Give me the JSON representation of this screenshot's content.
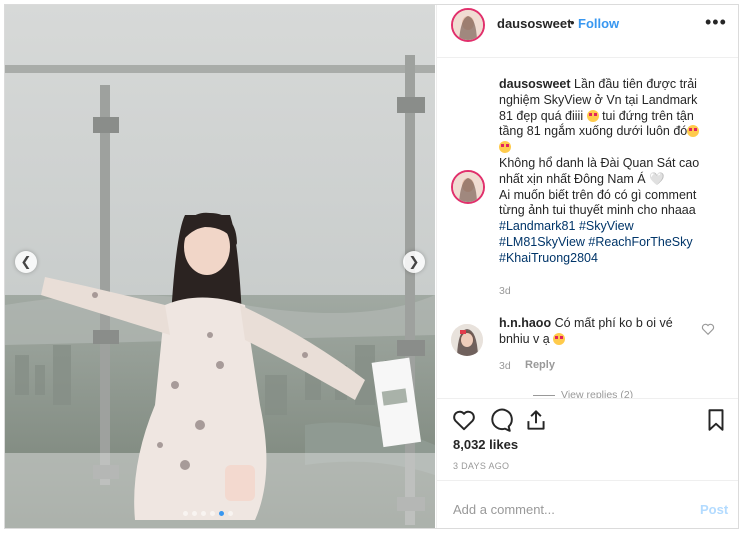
{
  "post": {
    "username": "dausosweet",
    "separator": "•",
    "follow_label": "Follow",
    "more_icon": "more-options-icon",
    "photo": {
      "carousel_dot_count": 6,
      "active_dot_index": 4,
      "prev_icon": "chevron-left-icon",
      "next_icon": "chevron-right-icon"
    },
    "caption": {
      "username": "dausosweet",
      "line1": "Lần đầu tiên được trải nghiệm SkyView ở Vn tại Landmark 81 đẹp quá điiii",
      "line1b": "tui đứng trên tận tầng 81 ngắm xuống dưới luôn đó",
      "line2": "Không hổ danh là Đài Quan Sát cao nhất xịn nhất Đông Nam Á 🤍",
      "line3": "Ai muốn biết trên đó có gì comment từng ảnh tui thuyết minh cho nhaaa",
      "hashtags": [
        "#Landmark81",
        "#SkyView",
        "#LM81SkyView",
        "#ReachForTheSky",
        "#KhaiTruong2804"
      ],
      "time": "3d"
    },
    "comment": {
      "username": "h.n.haoo",
      "text": "Có mất phí ko b oi vé bnhiu v ạ",
      "time": "3d",
      "reply_label": "Reply",
      "view_replies": "View replies (2)"
    },
    "likes": "8,032 likes",
    "posted_ago": "3 DAYS AGO",
    "add_comment_placeholder": "Add a comment...",
    "post_label": "Post"
  },
  "colors": {
    "link_blue": "#3897f0",
    "hashtag": "#003569",
    "muted": "#999999",
    "border": "#efefef"
  }
}
